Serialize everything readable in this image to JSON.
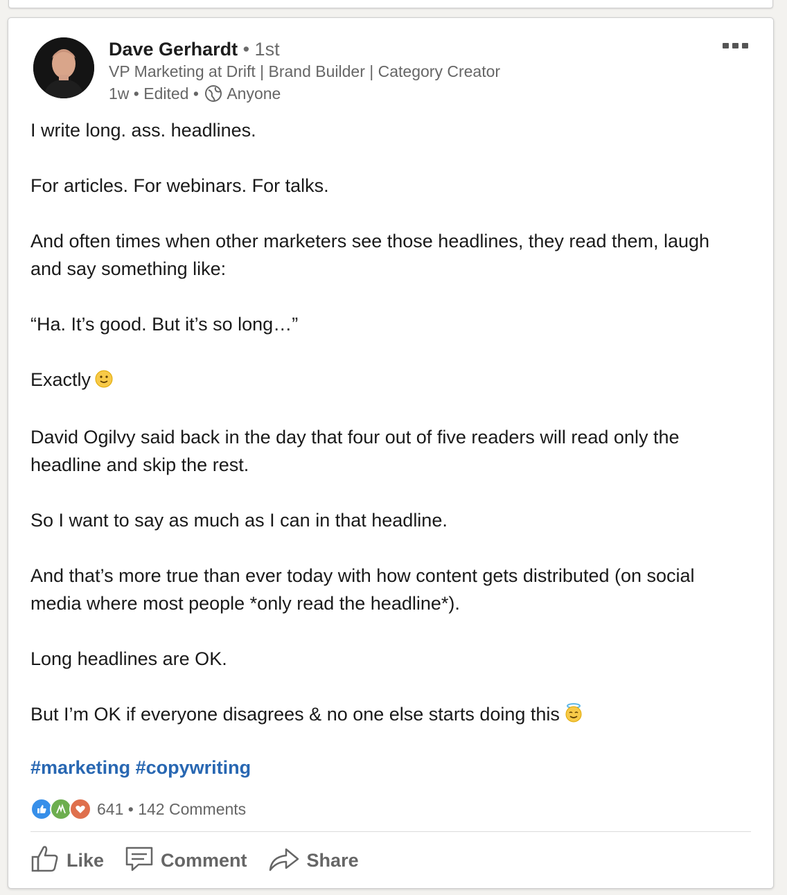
{
  "post": {
    "author": {
      "name": "Dave Gerhardt",
      "degree": "• 1st",
      "headline": "VP Marketing at Drift | Brand Builder | Category Creator",
      "time": "1w",
      "edited": "Edited",
      "visibility": "Anyone"
    },
    "body": [
      "I write long. ass. headlines.",
      "For articles. For webinars. For talks.",
      "And often times when other marketers see those headlines, they read them, laugh and say something like:",
      "“Ha. It’s good. But it’s so long…”",
      "Exactly",
      "David Ogilvy said back in the day that four out of five readers will read only the headline and skip the rest.",
      "So I want to say as much as I can in that headline.",
      "And that’s more true than ever today with how content gets distributed (on social media where most people *only read the headline*).",
      "Long headlines are OK.",
      "But I’m OK if everyone disagrees & no one else starts doing this"
    ],
    "hashtags": [
      "#marketing",
      "#copywriting"
    ],
    "reactions_count": "641",
    "comments_count": "142 Comments",
    "reaction_icons": [
      "like-icon",
      "celebrate-icon",
      "love-icon"
    ]
  },
  "actions": {
    "like": "Like",
    "comment": "Comment",
    "share": "Share"
  },
  "colors": {
    "link": "#2867b2",
    "muted": "#666666",
    "like": "#378fe9",
    "celebrate": "#6dae4f",
    "love": "#df704d"
  }
}
